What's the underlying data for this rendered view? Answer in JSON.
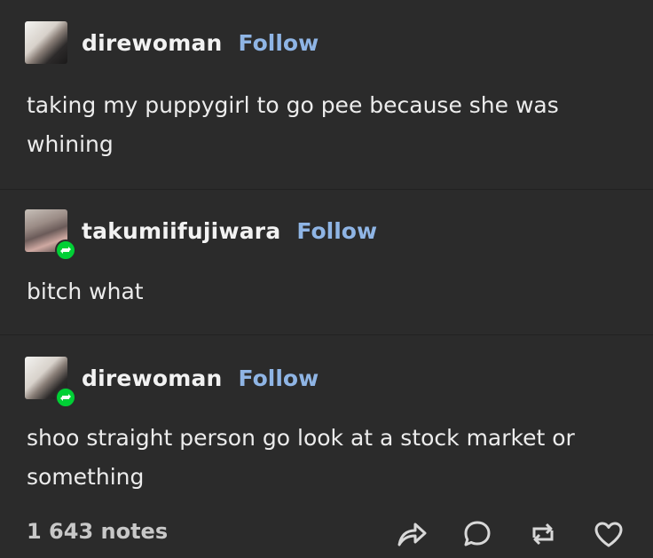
{
  "posts": [
    {
      "username": "direwoman",
      "follow_label": "Follow",
      "text": "taking my puppygirl to go pee because she was whining",
      "reblog": false
    },
    {
      "username": "takumiifujiwara",
      "follow_label": "Follow",
      "text": "bitch what",
      "reblog": true
    },
    {
      "username": "direwoman",
      "follow_label": "Follow",
      "text": "shoo straight person go look at a stock market or something",
      "reblog": true
    }
  ],
  "footer": {
    "notes": "1 643 notes",
    "actions": [
      "share-icon",
      "reply-icon",
      "reblog-icon",
      "like-icon"
    ]
  },
  "colors": {
    "background": "#2b2b2b",
    "follow": "#8fb5e5",
    "reblog_badge": "#00cf35"
  }
}
